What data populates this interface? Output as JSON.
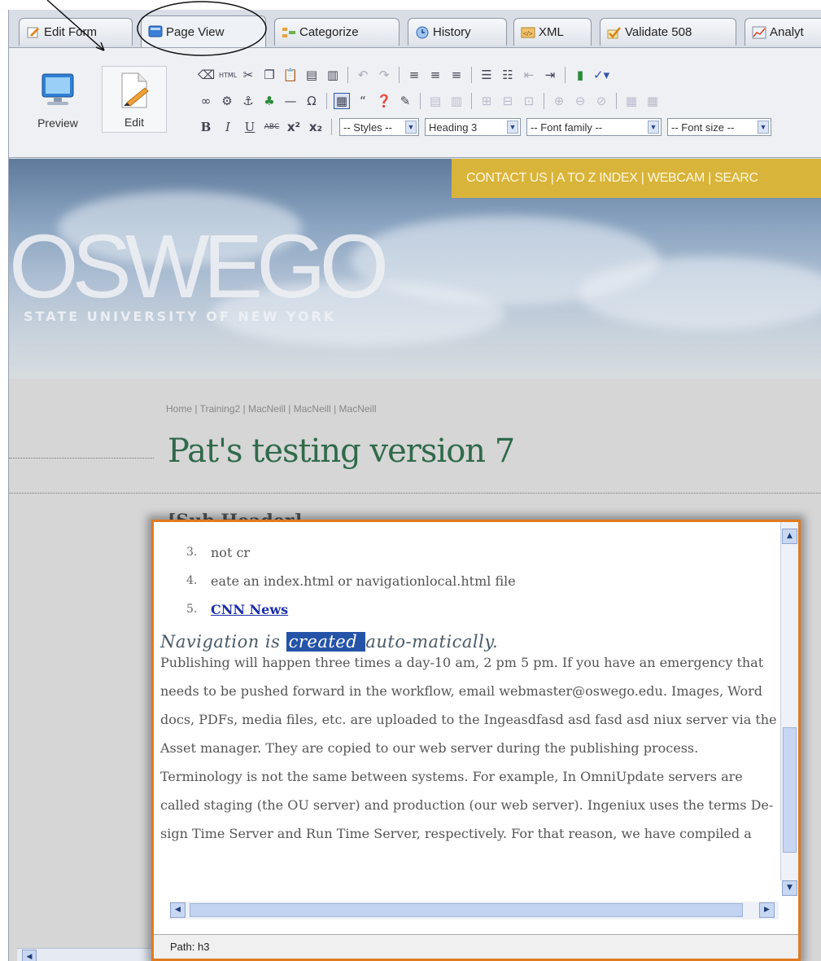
{
  "tabs": [
    {
      "label": "Edit Form",
      "icon": "edit-form-icon"
    },
    {
      "label": "Page View",
      "icon": "page-view-icon"
    },
    {
      "label": "Categorize",
      "icon": "categorize-icon"
    },
    {
      "label": "History",
      "icon": "history-icon"
    },
    {
      "label": "XML",
      "icon": "xml-icon"
    },
    {
      "label": "Validate 508",
      "icon": "checkmark-icon"
    },
    {
      "label": "Analyt",
      "icon": "chart-icon"
    }
  ],
  "toolbar": {
    "preview_label": "Preview",
    "edit_label": "Edit",
    "styles_value": "-- Styles --",
    "heading_value": "Heading 3",
    "font_family_value": "-- Font family --",
    "font_size_value": "-- Font size --"
  },
  "banner": {
    "links": "CONTACT US | A TO Z INDEX | WEBCAM | SEARC",
    "logo": "OSWEGO",
    "logo_sub": "STATE UNIVERSITY OF NEW YORK"
  },
  "page": {
    "breadcrumb": "Home | Training2 | MacNeill | MacNeill | MacNeill",
    "title": "Pat's testing version 7",
    "sub_header": "[Sub Header]"
  },
  "editor": {
    "list": [
      {
        "num": "3.",
        "text": "not cr"
      },
      {
        "num": "4.",
        "text": "eate an index.html or navigationlocal.html file"
      },
      {
        "num": "5.",
        "text": "CNN News",
        "link": true
      }
    ],
    "heading_before": "Navigation is ",
    "heading_selected": "created ",
    "heading_after": "auto-matically.",
    "paragraph": "Publishing will happen three times a day-10 am, 2 pm 5 pm. If you have an emergency that needs to be pushed forward in the workflow, email webmaster@oswego.edu. Images, Word docs, PDFs, media files, etc. are uploaded to the Ingeasdfasd asd fasd asd niux server via the Asset manager. They are copied to our web server during the publishing process. Terminology is not the same between systems. For example, In OmniUpdate servers are called staging (the OU server) and production (our web server). Ingeniux uses the terms De-sign Time Server and Run Time Server, respectively. For that reason, we have compiled a",
    "path": "Path: h3"
  },
  "colors": {
    "accent_orange": "#e07b20",
    "banner_yellow": "#d9b43a",
    "title_green": "#2f6a4a",
    "selection_blue": "#2553a8"
  }
}
